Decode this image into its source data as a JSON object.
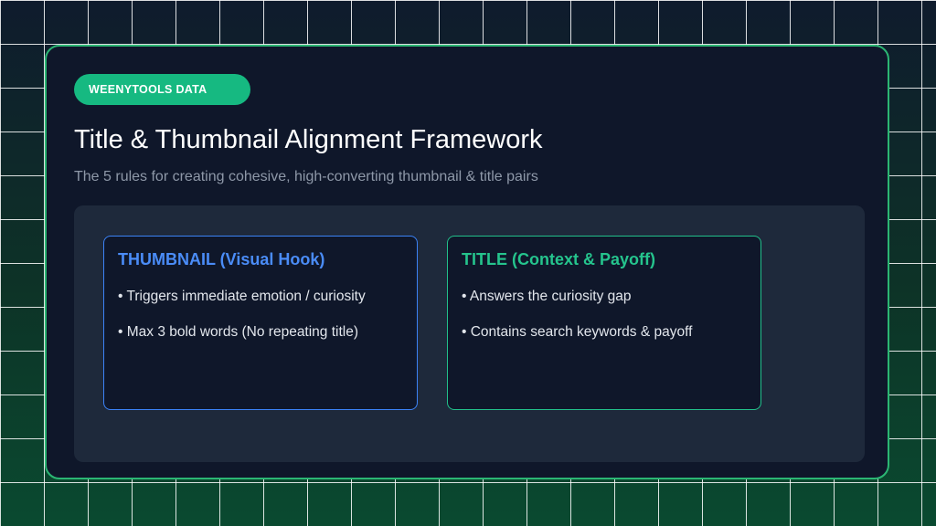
{
  "colors": {
    "accent_green": "#16b981",
    "thumbnail_blue": "#3b82f6",
    "title_green": "#22c08a",
    "card_bg": "#0f172a"
  },
  "badge": {
    "label": "WEENYTOOLS DATA"
  },
  "header": {
    "title": "Title & Thumbnail Alignment Framework",
    "subtitle": "The 5 rules for creating cohesive, high-converting thumbnail & title pairs"
  },
  "boxes": [
    {
      "heading": "THUMBNAIL (Visual Hook)",
      "bullets": [
        "• Triggers immediate emotion / curiosity",
        "• Max 3 bold words (No repeating title)"
      ]
    },
    {
      "heading": "TITLE (Context & Payoff)",
      "bullets": [
        "• Answers the curiosity gap",
        "• Contains search keywords & payoff"
      ]
    }
  ]
}
